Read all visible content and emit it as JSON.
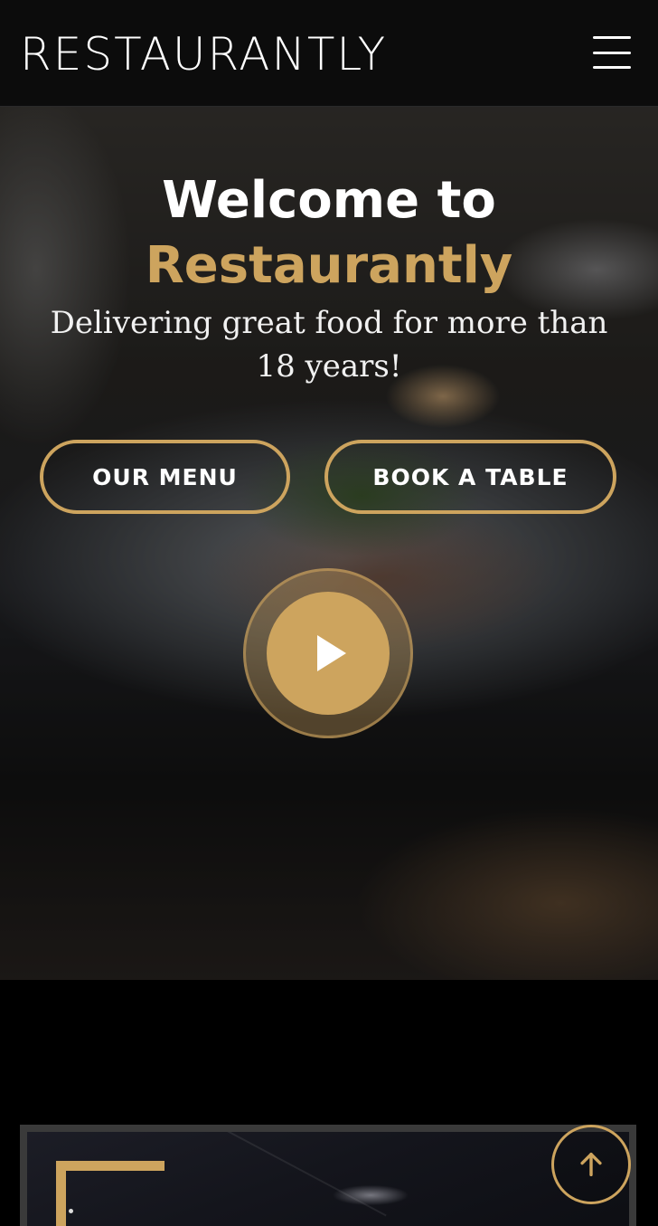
{
  "header": {
    "logo": "RESTAURANTLY",
    "menu_icon": "hamburger-menu-icon"
  },
  "hero": {
    "title_line1": "Welcome to",
    "title_line2": "Restaurantly",
    "subtitle": "Delivering great food for more than 18 years!",
    "buttons": {
      "menu_label": "OUR MENU",
      "book_label": "BOOK A TABLE"
    },
    "play_icon": "play-icon"
  },
  "back_to_top_icon": "arrow-up-icon",
  "colors": {
    "accent": "#cda45e",
    "header_bg": "#0c0c0c",
    "page_bg": "#000000"
  }
}
